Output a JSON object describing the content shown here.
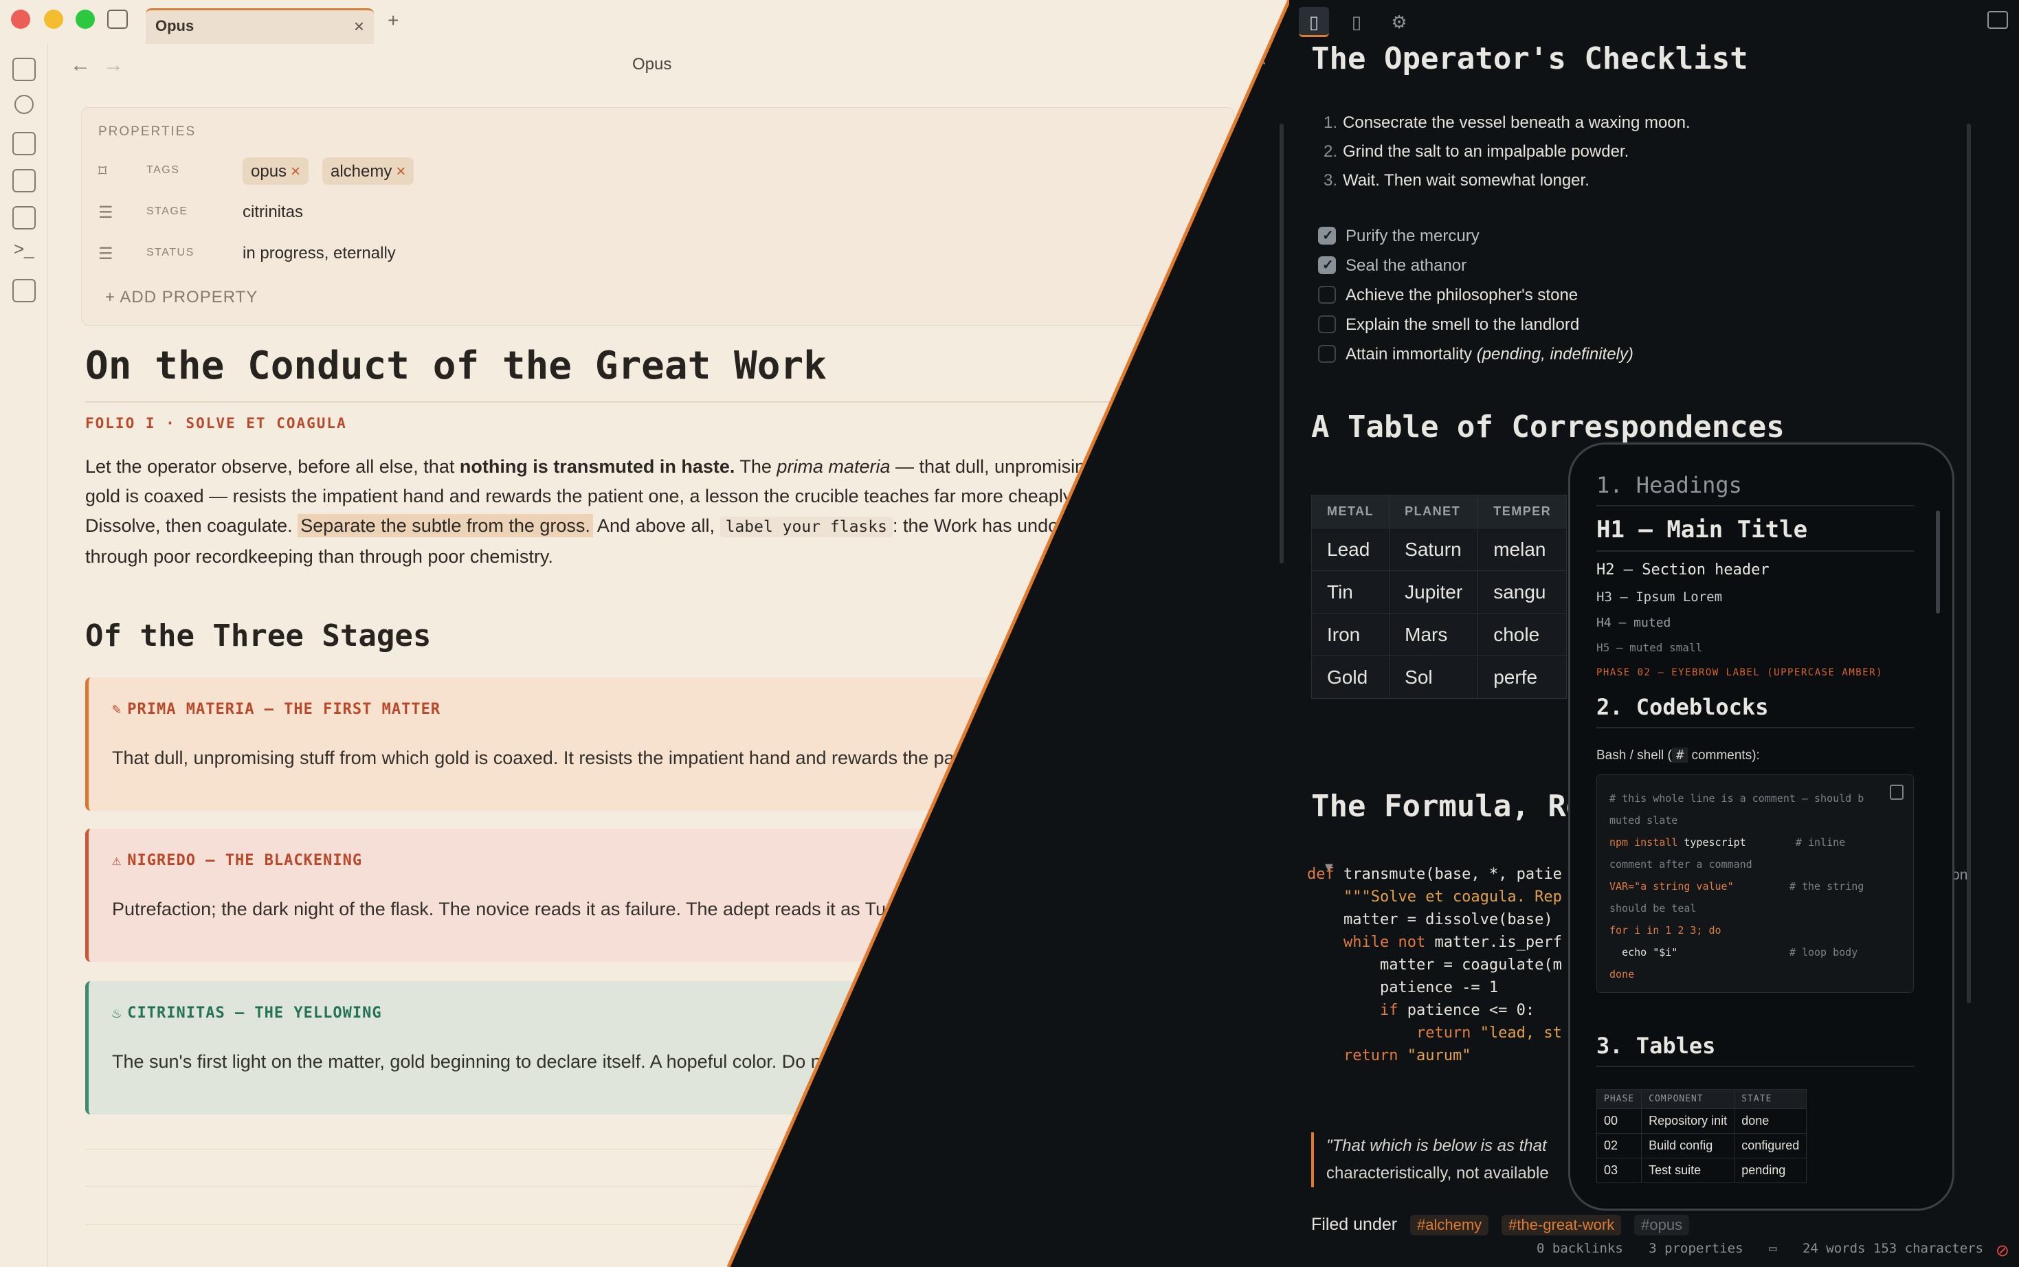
{
  "window": {
    "tab_title": "Opus",
    "note_title": "Opus"
  },
  "properties": {
    "heading": "PROPERTIES",
    "tags_key": "TAGS",
    "tags": [
      "opus",
      "alchemy"
    ],
    "stage_key": "STAGE",
    "stage_value": "citrinitas",
    "status_key": "STATUS",
    "status_value": "in progress, eternally",
    "add_label": "ADD PROPERTY"
  },
  "document": {
    "title": "On the Conduct of the Great Work",
    "eyebrow": "FOLIO I · SOLVE ET COAGULA",
    "intro": {
      "p1": "Let the operator observe, before all else, that ",
      "bold": "nothing is transmuted in haste.",
      "p2": " The ",
      "italic": "prima materia",
      "p3": " — that dull, unpromising stuff from which gold is coaxed — resists the impatient hand and rewards the patient one, a lesson the crucible teaches far more cheaply than a physician. Dissolve, then coagulate. ",
      "highlight": "Separate the subtle from the gross.",
      "p4": " And above all, ",
      "code": "label your flasks",
      "p5": ": the Work has undone more sages through poor recordkeeping than through poor chemistry."
    },
    "stages_heading": "Of the Three Stages",
    "callouts": [
      {
        "title": "PRIMA MATERIA — THE FIRST MATTER",
        "body": "That dull, unpromising stuff from which gold is coaxed. It resists the impatient hand and rewards the patient one."
      },
      {
        "title": "NIGREDO — THE BLACKENING",
        "body": "Putrefaction; the dark night of the flask. The novice reads it as failure. The adept reads it as Tuesday."
      },
      {
        "title": "CITRINITAS — THE YELLOWING",
        "body": "The sun's first light on the matter, gold beginning to declare itself. A hopeful color. Do not trust it completely."
      }
    ]
  },
  "right": {
    "checklist_heading": "The Operator's Checklist",
    "ordered": [
      "Consecrate the vessel beneath a waxing moon.",
      "Grind the salt to an impalpable powder.",
      "Wait. Then wait somewhat longer."
    ],
    "tasks": [
      {
        "text": "Purify the mercury",
        "done": true
      },
      {
        "text": "Seal the athanor",
        "done": true
      },
      {
        "text": "Achieve the philosopher's stone",
        "done": false
      },
      {
        "text": "Explain the smell to the landlord",
        "done": false
      },
      {
        "text": "Attain immortality",
        "italic": "(pending, indefinitely)",
        "done": false
      }
    ],
    "table_heading": "A Table of Correspondences",
    "table_headers": [
      "METAL",
      "PLANET",
      "TEMPER"
    ],
    "table_rows": [
      [
        "Lead",
        "Saturn",
        "melan"
      ],
      [
        "Tin",
        "Jupiter",
        "sangu"
      ],
      [
        "Iron",
        "Mars",
        "chole"
      ],
      [
        "Gold",
        "Sol",
        "perfe"
      ]
    ],
    "formula_heading": "The Formula, Re",
    "code_lang": "ython",
    "quote_line1": "\"That which is below is as that",
    "quote_line2": "characteristically, not available",
    "filed_under": "Filed under",
    "filed_tags": [
      "#alchemy",
      "#the-great-work",
      "#opus"
    ],
    "status_bar": [
      "0 backlinks",
      "3 properties",
      "24 words 153 characters"
    ]
  },
  "phone": {
    "s1": "1. Headings",
    "h1": "H1 — Main Title",
    "h2": "H2 — Section header",
    "h3": "H3 — Ipsum Lorem",
    "h4": "H4 — muted",
    "h5": "H5 — muted small",
    "eyebrow": "PHASE 02 — EYEBROW LABEL (UPPERCASE AMBER)",
    "s2": "2. Codeblocks",
    "bash_pre": "Bash / shell (",
    "bash_code": "#",
    "bash_post": " comments):",
    "s3": "3. Tables",
    "table_headers": [
      "PHASE",
      "COMPONENT",
      "STATE"
    ],
    "table_rows": [
      [
        "00",
        "Repository init",
        "done"
      ],
      [
        "02",
        "Build config",
        "configured"
      ],
      [
        "03",
        "Test suite",
        "pending"
      ]
    ]
  },
  "colors": {
    "accent": "#e07b2f",
    "light_bg": "#f5ece0",
    "dark_bg": "#0f1215",
    "prima": "#d8772f",
    "nigredo": "#c95733",
    "citrinitas": "#3e8a70"
  }
}
